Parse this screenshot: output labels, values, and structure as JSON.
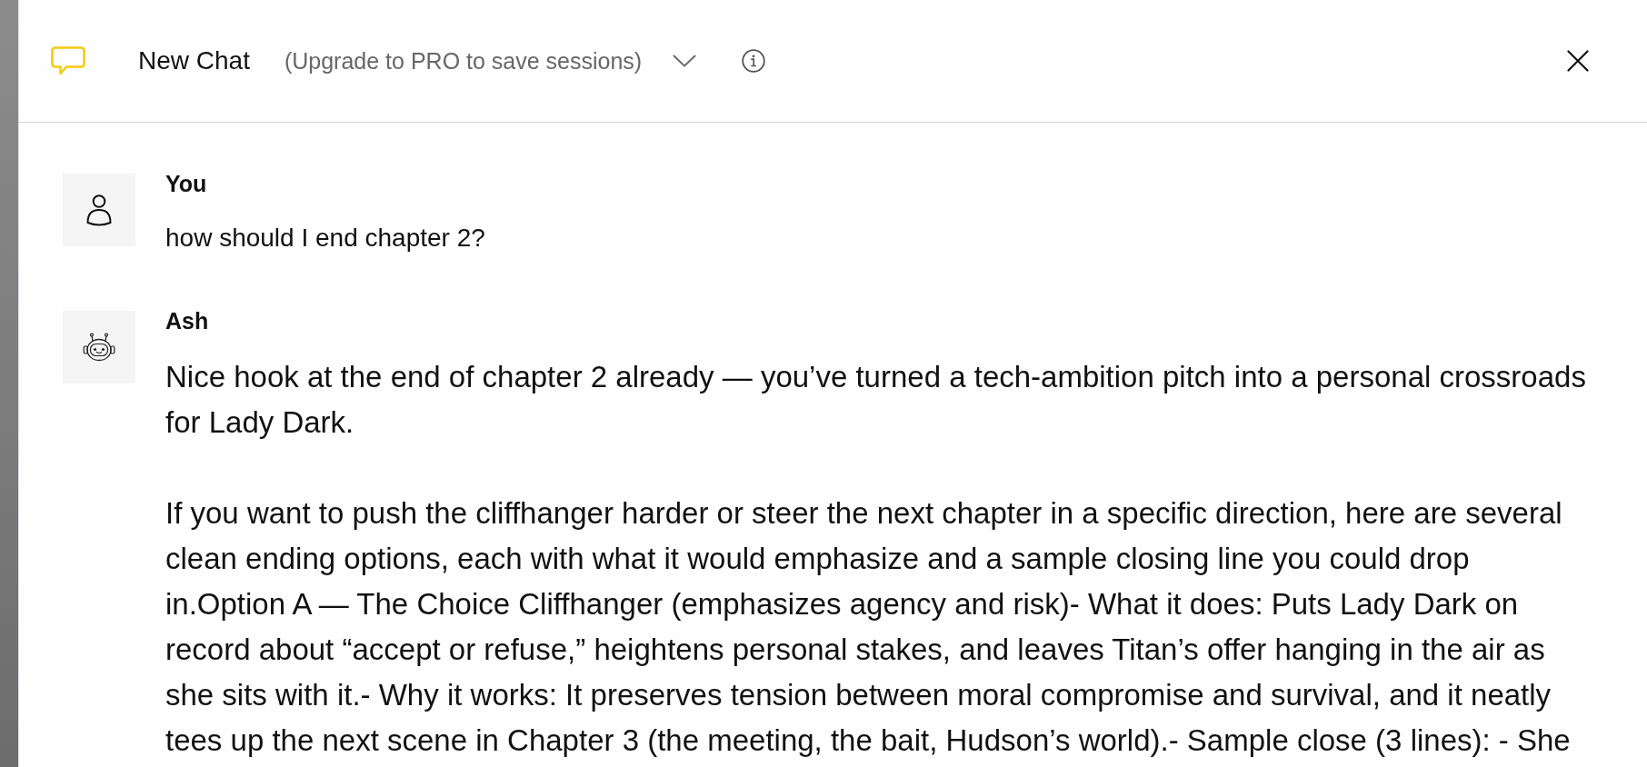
{
  "header": {
    "title": "New Chat",
    "subtitle": "(Upgrade to PRO to save sessions)"
  },
  "messages": [
    {
      "kind": "user",
      "author": "You",
      "paragraphs": [
        "how should I end chapter 2?"
      ]
    },
    {
      "kind": "assistant",
      "author": "Ash",
      "paragraphs": [
        "Nice hook at the end of chapter 2 already — you’ve turned a tech-ambition pitch into a personal crossroads for Lady Dark.",
        "If you want to push the cliffhanger harder or steer the next chapter in a specific direction, here are several clean ending options, each with what it would emphasize and a sample closing line you could drop in.Option A — The Choice Cliffhanger (emphasizes agency and risk)- What it does: Puts Lady Dark on record about “accept or refuse,” heightens personal stakes, and leaves Titan’s offer hanging in the air as she sits with it.- Why it works: It preserves tension between moral compromise and survival, and it neatly tees up the next scene in Chapter 3 (the meeting, the bait, Hudson’s world).- Sample close (3 lines): - She"
      ]
    }
  ]
}
